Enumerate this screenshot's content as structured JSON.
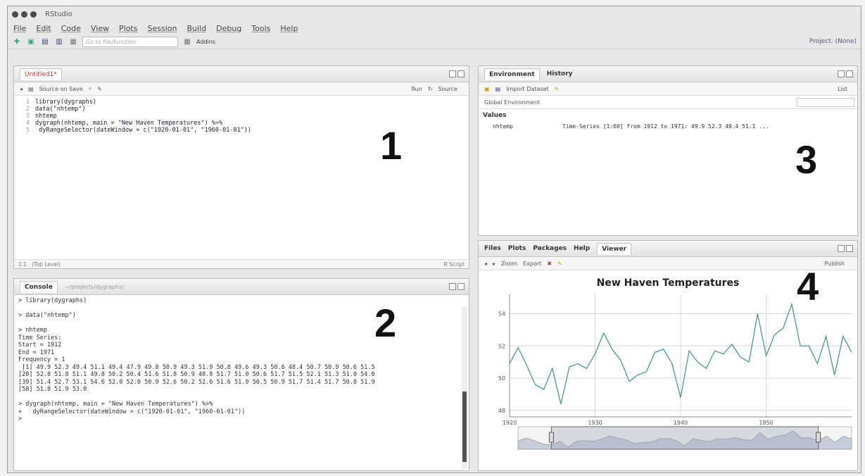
{
  "window": {
    "title": "RStudio"
  },
  "menu": [
    "File",
    "Edit",
    "Code",
    "View",
    "Plots",
    "Session",
    "Build",
    "Debug",
    "Tools",
    "Help"
  ],
  "toolbar": {
    "goto_placeholder": "Go to file/function",
    "addins": "Addins",
    "project": "Project: (None)"
  },
  "source": {
    "tab": "Untitled1*",
    "source_on_save": "Source on Save",
    "run": "Run",
    "source_btn": "Source",
    "lines": [
      "library(dygraphs)",
      "data(\"nhtemp\")",
      "nhtemp",
      "dygraph(nhtemp, main = \"New Haven Temperatures\") %>%",
      "  dyRangeSelector(dateWindow = c(\"1920-01-01\", \"1960-01-01\"))"
    ],
    "status_pos": "1:1",
    "status_scope": "(Top Level)",
    "status_type": "R Script",
    "label": "1"
  },
  "console": {
    "tab": "Console",
    "path": "~/projects/dygraphs/",
    "output": "> library(dygraphs)\n\n> data(\"nhtemp\")\n\n> nhtemp\nTime Series:\nStart = 1912\nEnd = 1971\nFrequency = 1\n [1] 49.9 52.3 49.4 51.1 49.4 47.9 49.8 50.9 49.3 51.9 50.8 49.6 49.3 50.6 48.4 50.7 50.9 50.6 51.5\n[20] 52.8 51.8 51.1 49.8 50.2 50.4 51.6 51.8 50.9 48.8 51.7 51.0 50.6 51.7 51.5 52.1 51.3 51.0 54.0\n[39] 51.4 52.7 53.1 54.6 52.0 52.0 50.9 52.6 50.2 52.6 51.6 51.9 50.5 50.9 51.7 51.4 51.7 50.8 51.9\n[58] 51.8 51.9 53.0\n\n> dygraph(nhtemp, main = \"New Haven Temperatures\") %>%\n+   dyRangeSelector(dateWindow = c(\"1920-01-01\", \"1960-01-01\"))\n> ",
    "label": "2"
  },
  "environment": {
    "tabs": [
      "Environment",
      "History"
    ],
    "import": "Import Dataset",
    "list": "List",
    "scope": "Global Environment",
    "section": "Values",
    "var_name": "nhtemp",
    "var_value": "Time-Series [1:60] from 1912 to 1971: 49.9 52.3 49.4 51.1 ...",
    "label": "3"
  },
  "viewer": {
    "tabs": [
      "Files",
      "Plots",
      "Packages",
      "Help",
      "Viewer"
    ],
    "zoom": "Zoom",
    "export": "Export",
    "publish": "Publish",
    "label": "4"
  },
  "chart_data": {
    "type": "line",
    "title": "New Haven Temperatures",
    "xlabel": "",
    "ylabel": "",
    "x": [
      1920,
      1921,
      1922,
      1923,
      1924,
      1925,
      1926,
      1927,
      1928,
      1929,
      1930,
      1931,
      1932,
      1933,
      1934,
      1935,
      1936,
      1937,
      1938,
      1939,
      1940,
      1941,
      1942,
      1943,
      1944,
      1945,
      1946,
      1947,
      1948,
      1949,
      1950,
      1951,
      1952,
      1953,
      1954,
      1955,
      1956,
      1957,
      1958,
      1959,
      1960
    ],
    "series": [
      {
        "values": [
          50.9,
          51.9,
          50.8,
          49.6,
          49.3,
          50.6,
          48.4,
          50.7,
          50.9,
          50.6,
          51.5,
          52.8,
          51.8,
          51.1,
          49.8,
          50.2,
          50.4,
          51.6,
          51.8,
          50.9,
          48.8,
          51.7,
          51.0,
          50.6,
          51.7,
          51.5,
          52.1,
          51.3,
          51.0,
          54.0,
          51.4,
          52.7,
          53.1,
          54.6,
          52.0,
          52.0,
          50.9,
          52.6,
          50.2,
          52.6,
          51.6
        ],
        "color": "#4a9a8e"
      }
    ],
    "xticks": [
      "1920",
      "1930",
      "1940",
      "1950"
    ],
    "yticks": [
      "48",
      "50",
      "52",
      "54"
    ],
    "ylim": [
      47.6,
      55.2
    ],
    "xlim": [
      1920,
      1960
    ],
    "grid": true
  }
}
